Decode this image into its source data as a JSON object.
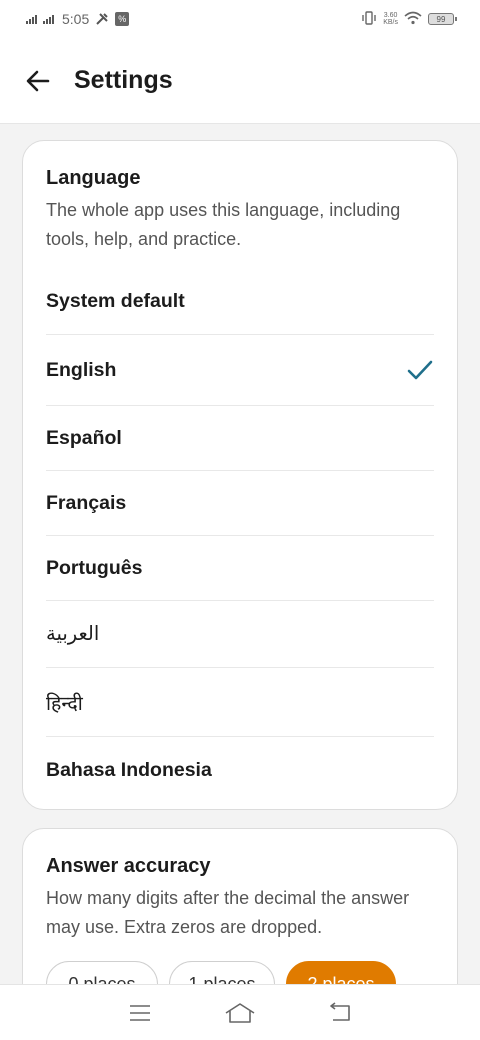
{
  "status_bar": {
    "time": "5:05",
    "network_speed_top": "3.60",
    "network_speed_bottom": "KB/s",
    "battery_level": "99"
  },
  "header": {
    "title": "Settings"
  },
  "language_card": {
    "title": "Language",
    "description": "The whole app uses this language, including tools, help, and practice.",
    "selected": "English",
    "items": [
      {
        "label": "System default",
        "native": false
      },
      {
        "label": "English",
        "native": false
      },
      {
        "label": "Español",
        "native": false
      },
      {
        "label": "Français",
        "native": false
      },
      {
        "label": "Português",
        "native": false
      },
      {
        "label": "العربية",
        "native": true
      },
      {
        "label": "हिन्दी",
        "native": true
      },
      {
        "label": "Bahasa Indonesia",
        "native": false
      }
    ]
  },
  "accuracy_card": {
    "title": "Answer accuracy",
    "description": "How many digits after the decimal the answer may use. Extra zeros are dropped.",
    "options": [
      "0 places",
      "1 places",
      "2 places"
    ],
    "selected": "2 places"
  },
  "colors": {
    "accent": "#e07b00",
    "check": "#1f6f8b"
  },
  "icons": {
    "back": "arrow-left-icon",
    "check": "check-icon",
    "nav_menu": "menu-icon",
    "nav_home": "home-icon",
    "nav_back": "back-icon"
  }
}
